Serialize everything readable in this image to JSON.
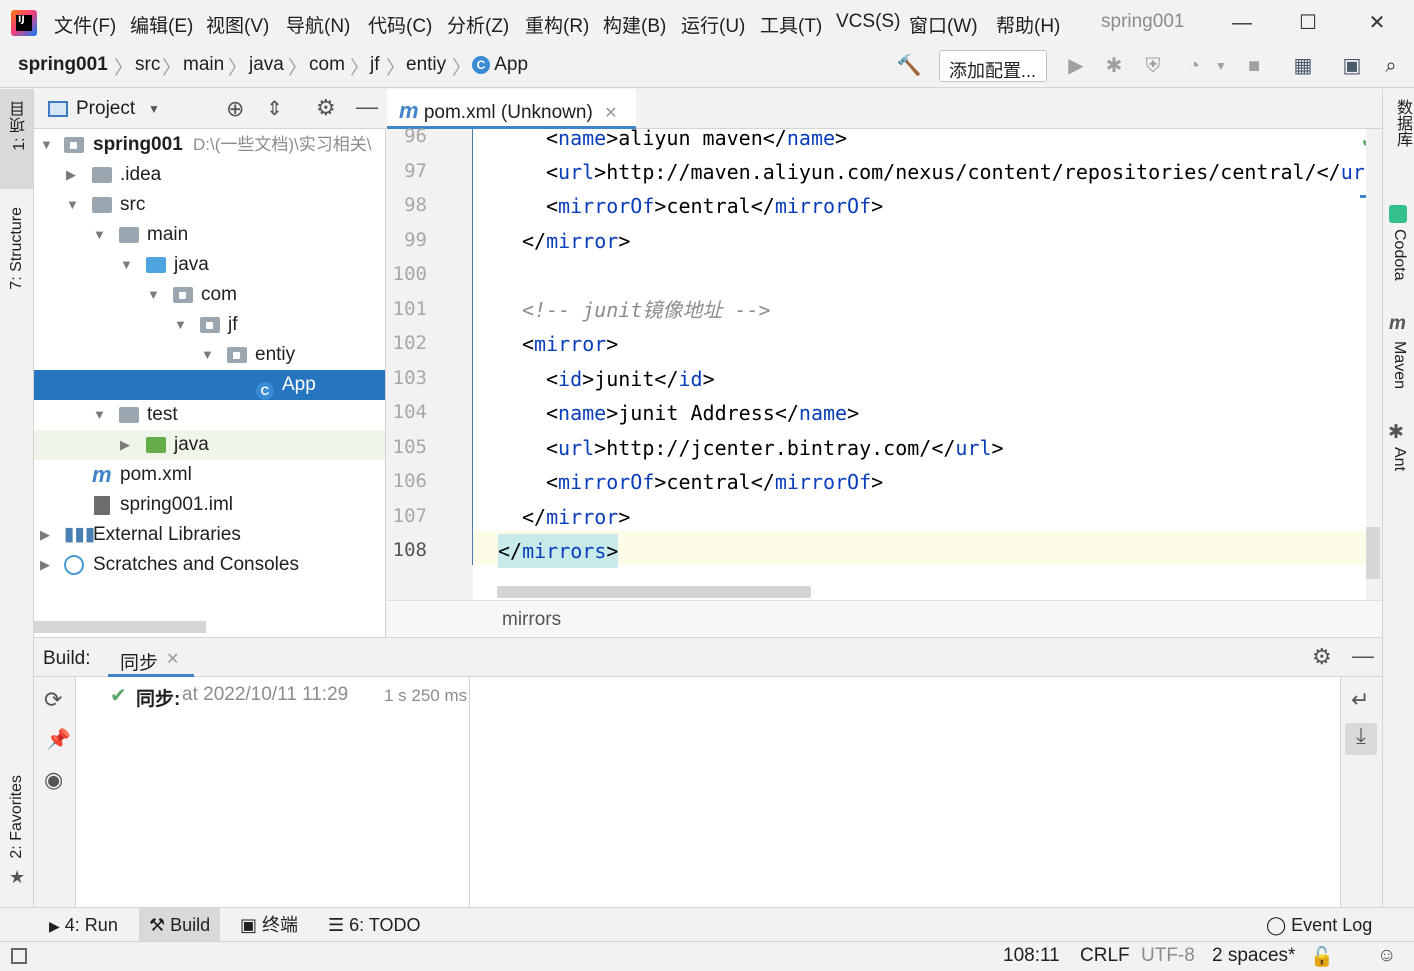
{
  "menubar": {
    "items": [
      "文件(F)",
      "编辑(E)",
      "视图(V)",
      "导航(N)",
      "代码(C)",
      "分析(Z)",
      "重构(R)",
      "构建(B)",
      "运行(U)",
      "工具(T)",
      "VCS(S)",
      "窗口(W)",
      "帮助(H)"
    ],
    "window_title": "spring001",
    "minimize": "—",
    "maximize": "☐",
    "close": "✕"
  },
  "navbar": {
    "crumbs": [
      "spring001",
      "src",
      "main",
      "java",
      "com",
      "jf",
      "entiy",
      "App"
    ],
    "run_config_label": "添加配置..."
  },
  "left_strip": {
    "project_tab": "1: 项目",
    "structure_tab": "7: Structure",
    "favorites_tab": "2: Favorites"
  },
  "right_strip": {
    "tabs": [
      "数据库",
      "Codota",
      "Maven",
      "Ant"
    ]
  },
  "project_panel": {
    "title": "Project",
    "tree": [
      {
        "label": "spring001",
        "hint": "D:\\(一些文档)\\实习相关\\",
        "type": "module"
      },
      {
        "label": ".idea",
        "type": "folder"
      },
      {
        "label": "src",
        "type": "folder"
      },
      {
        "label": "main",
        "type": "folder"
      },
      {
        "label": "java",
        "type": "source"
      },
      {
        "label": "com",
        "type": "package"
      },
      {
        "label": "jf",
        "type": "package"
      },
      {
        "label": "entiy",
        "type": "package"
      },
      {
        "label": "App",
        "type": "class"
      },
      {
        "label": "test",
        "type": "folder"
      },
      {
        "label": "java",
        "type": "test-source"
      },
      {
        "label": "pom.xml",
        "type": "maven"
      },
      {
        "label": "spring001.iml",
        "type": "file"
      },
      {
        "label": "External Libraries",
        "type": "libraries"
      },
      {
        "label": "Scratches and Consoles",
        "type": "scratches"
      }
    ]
  },
  "editor": {
    "tab_label": "pom.xml (Unknown)",
    "line_numbers": [
      "96",
      "97",
      "98",
      "99",
      "100",
      "101",
      "102",
      "103",
      "104",
      "105",
      "106",
      "107",
      "108"
    ],
    "breadcrumb": "mirrors"
  },
  "build_panel": {
    "title": "Build:",
    "tab": "同步",
    "status_label": "同步:",
    "status_time": "at 2022/10/11 11:29",
    "duration": "1 s 250 ms"
  },
  "bottom_tabs": {
    "run": "4: Run",
    "build": "Build",
    "terminal": "终端",
    "todo": "6: TODO",
    "event_log": "Event Log"
  },
  "statusbar": {
    "position": "108:11",
    "line_sep": "CRLF",
    "encoding": "UTF-8",
    "indent": "2 spaces*"
  },
  "colors": {
    "accent": "#2675bf",
    "xml_tag": "#0a3dba",
    "comment": "#8c8c8c",
    "success": "#59a869"
  }
}
